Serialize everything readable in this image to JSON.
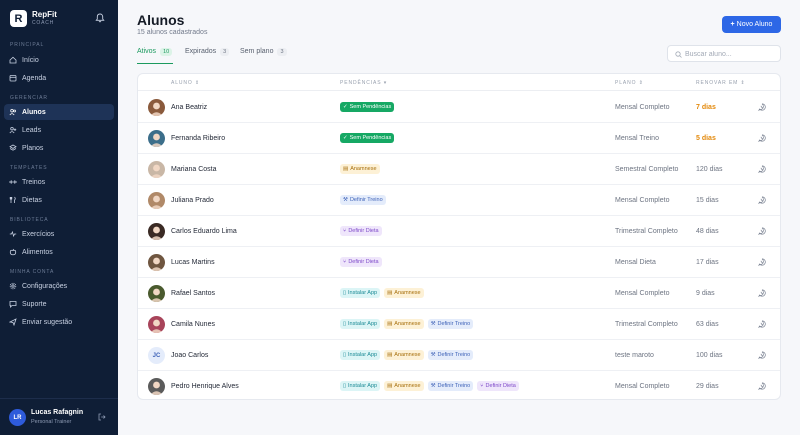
{
  "brand": {
    "name": "RepFit",
    "sub": "COACH",
    "logo_letter": "R"
  },
  "icons": {
    "bell": "bell-icon",
    "logout": "logout-icon",
    "search": "search-icon",
    "whatsapp": "whatsapp-icon"
  },
  "nav": {
    "sections": [
      {
        "title": "PRINCIPAL",
        "items": [
          {
            "label": "Início",
            "icon": "home-icon"
          },
          {
            "label": "Agenda",
            "icon": "calendar-icon"
          }
        ]
      },
      {
        "title": "GERENCIAR",
        "items": [
          {
            "label": "Alunos",
            "icon": "users-icon",
            "active": true
          },
          {
            "label": "Leads",
            "icon": "user-plus-icon"
          },
          {
            "label": "Planos",
            "icon": "layers-icon"
          }
        ]
      },
      {
        "title": "TEMPLATES",
        "items": [
          {
            "label": "Treinos",
            "icon": "dumbbell-icon"
          },
          {
            "label": "Dietas",
            "icon": "utensils-icon"
          }
        ]
      },
      {
        "title": "BIBLIOTECA",
        "items": [
          {
            "label": "Exercícios",
            "icon": "activity-icon"
          },
          {
            "label": "Alimentos",
            "icon": "apple-icon"
          }
        ]
      },
      {
        "title": "MINHA CONTA",
        "items": [
          {
            "label": "Configurações",
            "icon": "gear-icon"
          },
          {
            "label": "Suporte",
            "icon": "chat-icon"
          },
          {
            "label": "Enviar sugestão",
            "icon": "send-icon"
          }
        ]
      }
    ]
  },
  "user": {
    "initials": "LR",
    "name": "Lucas Rafagnin",
    "role": "Personal Trainer"
  },
  "header": {
    "title": "Alunos",
    "subtitle": "15 alunos cadastrados",
    "new_button": "Novo Aluno",
    "new_button_icon": "+"
  },
  "tabs": [
    {
      "label": "Ativos",
      "count": "10",
      "active": true
    },
    {
      "label": "Expirados",
      "count": "3"
    },
    {
      "label": "Sem plano",
      "count": "3"
    }
  ],
  "search": {
    "placeholder": "Buscar aluno...",
    "value": ""
  },
  "table": {
    "columns": {
      "aluno": "ALUNO ⇕",
      "pendencias": "PENDÊNCIAS ▾",
      "plano": "PLANO ⇕",
      "renovar": "RENOVAR EM ⇕"
    },
    "rows": [
      {
        "name": "Ana Beatriz",
        "avatar": "photo",
        "avatar_color": "#8a5a3c",
        "badges": [
          {
            "label": "Sem Pendências",
            "type": "green",
            "icon": "✓"
          }
        ],
        "plan": "Mensal Completo",
        "days": "7 dias",
        "warn": true
      },
      {
        "name": "Fernanda Ribeiro",
        "avatar": "photo",
        "avatar_color": "#3c6e8a",
        "badges": [
          {
            "label": "Sem Pendências",
            "type": "green",
            "icon": "✓"
          }
        ],
        "plan": "Mensal Treino",
        "days": "5 dias",
        "warn": true
      },
      {
        "name": "Mariana Costa",
        "avatar": "photo",
        "avatar_color": "#c9b7a6",
        "badges": [
          {
            "label": "Anamnese",
            "type": "yellow",
            "icon": "▤"
          }
        ],
        "plan": "Semestral Completo",
        "days": "120 dias"
      },
      {
        "name": "Juliana Prado",
        "avatar": "photo",
        "avatar_color": "#b08968",
        "badges": [
          {
            "label": "Definir Treino",
            "type": "blue",
            "icon": "⚒"
          }
        ],
        "plan": "Mensal Completo",
        "days": "15 dias"
      },
      {
        "name": "Carlos Eduardo Lima",
        "avatar": "photo",
        "avatar_color": "#3a2a24",
        "badges": [
          {
            "label": "Definir Dieta",
            "type": "purple",
            "icon": "⑂"
          }
        ],
        "plan": "Trimestral Completo",
        "days": "48 dias"
      },
      {
        "name": "Lucas Martins",
        "avatar": "photo",
        "avatar_color": "#6f5640",
        "badges": [
          {
            "label": "Definir Dieta",
            "type": "purple",
            "icon": "⑂"
          }
        ],
        "plan": "Mensal Dieta",
        "days": "17 dias"
      },
      {
        "name": "Rafael Santos",
        "avatar": "photo",
        "avatar_color": "#4a5a2e",
        "badges": [
          {
            "label": "Instalar App",
            "type": "teal",
            "icon": "▯"
          },
          {
            "label": "Anamnese",
            "type": "yellow",
            "icon": "▤"
          }
        ],
        "plan": "Mensal Completo",
        "days": "9 dias"
      },
      {
        "name": "Camila Nunes",
        "avatar": "photo",
        "avatar_color": "#a8445a",
        "badges": [
          {
            "label": "Instalar App",
            "type": "teal",
            "icon": "▯"
          },
          {
            "label": "Anamnese",
            "type": "yellow",
            "icon": "▤"
          },
          {
            "label": "Definir Treino",
            "type": "blue",
            "icon": "⚒"
          }
        ],
        "plan": "Trimestral Completo",
        "days": "63 dias"
      },
      {
        "name": "Joao Carlos",
        "avatar": "initials",
        "initials": "JC",
        "avatar_color": "#e4ecfb",
        "badges": [
          {
            "label": "Instalar App",
            "type": "teal",
            "icon": "▯"
          },
          {
            "label": "Anamnese",
            "type": "yellow",
            "icon": "▤"
          },
          {
            "label": "Definir Treino",
            "type": "blue",
            "icon": "⚒"
          }
        ],
        "plan": "teste maroto",
        "days": "100 dias"
      },
      {
        "name": "Pedro Henrique Alves",
        "avatar": "photo",
        "avatar_color": "#5b5b5b",
        "badges": [
          {
            "label": "Instalar App",
            "type": "teal",
            "icon": "▯"
          },
          {
            "label": "Anamnese",
            "type": "yellow",
            "icon": "▤"
          },
          {
            "label": "Definir Treino",
            "type": "blue",
            "icon": "⚒"
          },
          {
            "label": "Definir Dieta",
            "type": "purple",
            "icon": "⑂"
          }
        ],
        "plan": "Mensal Completo",
        "days": "29 dias"
      }
    ]
  }
}
